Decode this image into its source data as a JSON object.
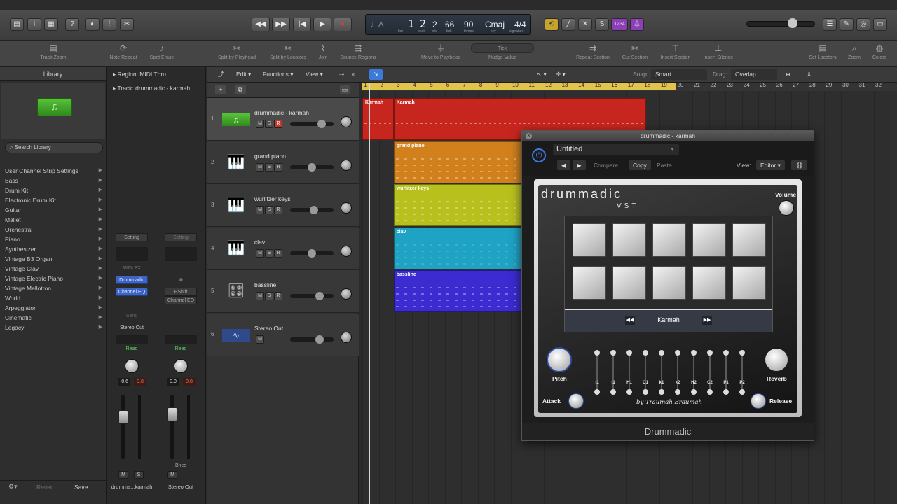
{
  "transport": {
    "bar": "1",
    "beat": "2",
    "division": "2",
    "tick": "66",
    "tempo": "90",
    "key": "Cmaj",
    "signature": "4/4",
    "sub_bar": "bar",
    "sub_beat": "beat",
    "sub_div": "div",
    "sub_tick": "tick",
    "sub_tempo": "tempo",
    "sub_key": "key",
    "sub_sig": "signature",
    "buttons": [
      "rewind-icon",
      "fast-forward-icon",
      "go-to-start-icon",
      "play-icon",
      "record-icon"
    ],
    "cycle_color": "#e2c34b",
    "tuner_label": "1234"
  },
  "toolbar": {
    "items": [
      "Track Zoom",
      "Note Repeat",
      "Spot Erase",
      "Split by Playhead",
      "Split by Locators",
      "Join",
      "Bounce Regions",
      "Move to Playhead",
      "Nudge Value",
      "Repeat Section",
      "Cut Section",
      "Insert Section",
      "Insert Silence",
      "Set Locators",
      "Zoom",
      "Colors"
    ],
    "nudge": "Tick"
  },
  "library": {
    "title": "Library",
    "search_placeholder": "Search Library",
    "items": [
      "User Channel Strip Settings",
      "Bass",
      "Drum Kit",
      "Electronic Drum Kit",
      "Guitar",
      "Mallet",
      "Orchestral",
      "Piano",
      "Synthesizer",
      "Vintage B3 Organ",
      "Vintage Clav",
      "Vintage Electric Piano",
      "Vintage Mellotron",
      "World",
      "Arpeggiator",
      "Cinematic",
      "Legacy"
    ],
    "revert": "Revert",
    "save": "Save..."
  },
  "inspector": {
    "region_header": "Region: MIDI Thru",
    "track_header": "Track: drummadic - karmah",
    "strip1": {
      "setting": "Setting",
      "midi_fx": "MIDI FX",
      "instrument": "Drummadic",
      "eq": "Channel EQ",
      "send": "Send",
      "output": "Stereo Out",
      "automation": "Read",
      "pan_left": "-0.6",
      "pan_right": "0.8",
      "name": "drumma...karmah"
    },
    "strip2": {
      "setting": "Setting",
      "link": "⊜",
      "plugin1": "PShift",
      "plugin2": "Channel EQ",
      "automation": "Read",
      "pan_left": "0.0",
      "pan_right": "0.8",
      "bounce": "Bnce",
      "name": "Stereo Out"
    },
    "mute": "M",
    "solo": "S"
  },
  "tracks_header": {
    "edit": "Edit",
    "functions": "Functions",
    "view": "View",
    "snap_label": "Snap:",
    "snap_value": "Smart",
    "drag_label": "Drag:",
    "drag_value": "Overlap"
  },
  "ruler": {
    "bars": [
      "1",
      "2",
      "3",
      "4",
      "5",
      "6",
      "7",
      "8",
      "9",
      "10",
      "11",
      "12",
      "13",
      "14",
      "15",
      "16",
      "17",
      "18",
      "19",
      "20",
      "21",
      "22",
      "23",
      "24",
      "25",
      "26",
      "27",
      "28",
      "29",
      "30",
      "31",
      "32"
    ],
    "cycle_start": 1,
    "cycle_end": 20
  },
  "tracks": [
    {
      "num": "1",
      "name": "drummadic - karmah",
      "icon": "♫",
      "mute": "M",
      "solo": "S",
      "rec": "R",
      "volume": 0.7
    },
    {
      "num": "2",
      "name": "grand piano",
      "icon": "🎹",
      "mute": "M",
      "solo": "S",
      "rec": "R",
      "volume": 0.45
    },
    {
      "num": "3",
      "name": "wurlitzer keys",
      "icon": "🎹",
      "mute": "M",
      "solo": "S",
      "rec": "R",
      "volume": 0.5
    },
    {
      "num": "4",
      "name": "clav",
      "icon": "🎹",
      "mute": "M",
      "solo": "S",
      "rec": "R",
      "volume": 0.45
    },
    {
      "num": "5",
      "name": "bassline",
      "icon": "🎛",
      "mute": "M",
      "solo": "S",
      "rec": "R",
      "volume": 0.65
    },
    {
      "num": "6",
      "name": "Stereo Out",
      "icon": "∿",
      "mute": "M",
      "volume": 0.65
    }
  ],
  "regions": [
    {
      "label": "Karmah",
      "color": "#c7261f",
      "track": 0,
      "start_bar": 1,
      "end_bar": 2.9
    },
    {
      "label": "Karmah",
      "color": "#c7261f",
      "track": 0,
      "start_bar": 2.9,
      "end_bar": 18.2
    },
    {
      "label": "grand piano",
      "color": "#d1801c",
      "track": 1,
      "start_bar": 2.9,
      "end_bar": 13.1
    },
    {
      "label": "wurlitzer keys",
      "color": "#b8c01e",
      "track": 2,
      "start_bar": 2.9,
      "end_bar": 13.1
    },
    {
      "label": "clav",
      "color": "#1ea3c4",
      "track": 3,
      "start_bar": 2.9,
      "end_bar": 13.1
    },
    {
      "label": "bassline",
      "color": "#3b2bd0",
      "track": 4,
      "start_bar": 2.9,
      "end_bar": 13.1
    }
  ],
  "plugin": {
    "title": "drummadic - karmah",
    "preset": "Untitled",
    "compare": "Compare",
    "copy": "Copy",
    "paste": "Paste",
    "view_label": "View:",
    "view_value": "Editor",
    "brand": "drummadic",
    "brand_sub": "VST",
    "volume_label": "Volume",
    "kit_name": "Karmah",
    "pitch_label": "Pitch",
    "reverb_label": "Reverb",
    "attack_label": "Attack",
    "release_label": "Release",
    "slider_labels": [
      "t1",
      "t1",
      "H1",
      "C1",
      "k1",
      "k2",
      "H2",
      "C2",
      "P1",
      "P2"
    ],
    "signature": "by Traumah Braumah",
    "footer": "Drummadic"
  }
}
